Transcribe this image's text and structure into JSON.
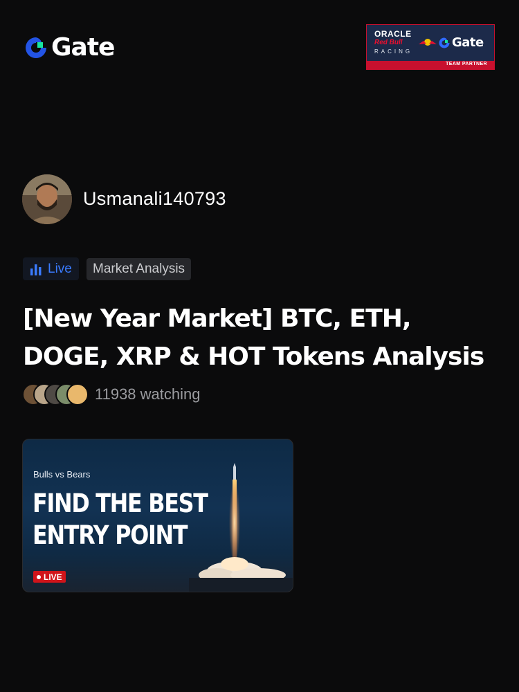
{
  "header": {
    "brand_name": "Gate",
    "brand_colors": {
      "blue": "#2354e6",
      "green": "#17e6a1"
    },
    "partner_badge": {
      "line1": "ORACLE",
      "line2": "Red Bull",
      "line3": "RACING",
      "brand": "Gate",
      "band_text": "TEAM PARTNER"
    }
  },
  "profile": {
    "username": "Usmanali140793",
    "avatar_icon": "user-avatar"
  },
  "tags": {
    "live_label": "Live",
    "live_icon": "bar-chart-icon",
    "topic_label": "Market Analysis",
    "accent": "#3a7bff"
  },
  "stream": {
    "title": "[New Year Market] BTC, ETH, DOGE, XRP & HOT Tokens Analysis",
    "watching_count": "11938",
    "watching_label": "watching"
  },
  "thumbnail": {
    "subtitle": "Bulls vs Bears",
    "headline_line1": "FIND THE BEST",
    "headline_line2": "ENTRY POINT",
    "live_badge": "LIVE"
  }
}
